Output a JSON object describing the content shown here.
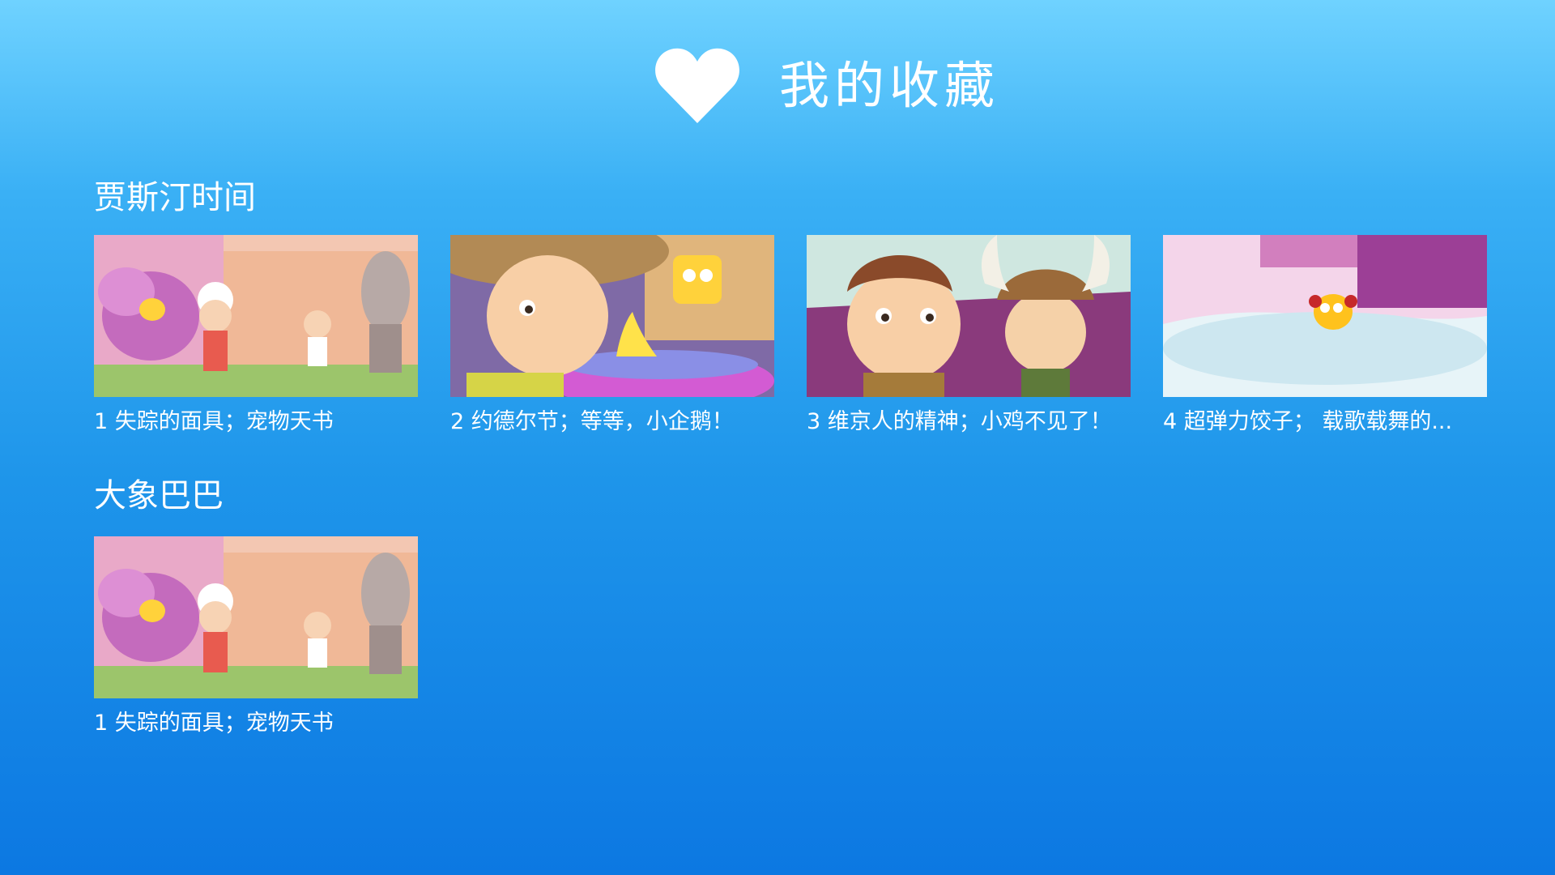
{
  "header": {
    "icon": "heart-icon",
    "title": "我的收藏"
  },
  "sections": [
    {
      "title": "贾斯汀时间",
      "items": [
        {
          "label": "1 失踪的面具；宠物天书",
          "thumbnail": "cartoon-scene-garden"
        },
        {
          "label": "2 约德尔节；等等，小企鹅！",
          "thumbnail": "cartoon-scene-hat-boy"
        },
        {
          "label": "3 维京人的精神；小鸡不见了！",
          "thumbnail": "cartoon-scene-viking"
        },
        {
          "label": "4 超弹力饺子； 载歌载舞的...",
          "thumbnail": "cartoon-scene-snow"
        }
      ]
    },
    {
      "title": "大象巴巴",
      "items": [
        {
          "label": "1 失踪的面具；宠物天书",
          "thumbnail": "cartoon-scene-garden"
        }
      ]
    }
  ],
  "colors": {
    "background_top": "#6fd2ff",
    "background_bottom": "#0c78e2",
    "text": "#ffffff"
  }
}
